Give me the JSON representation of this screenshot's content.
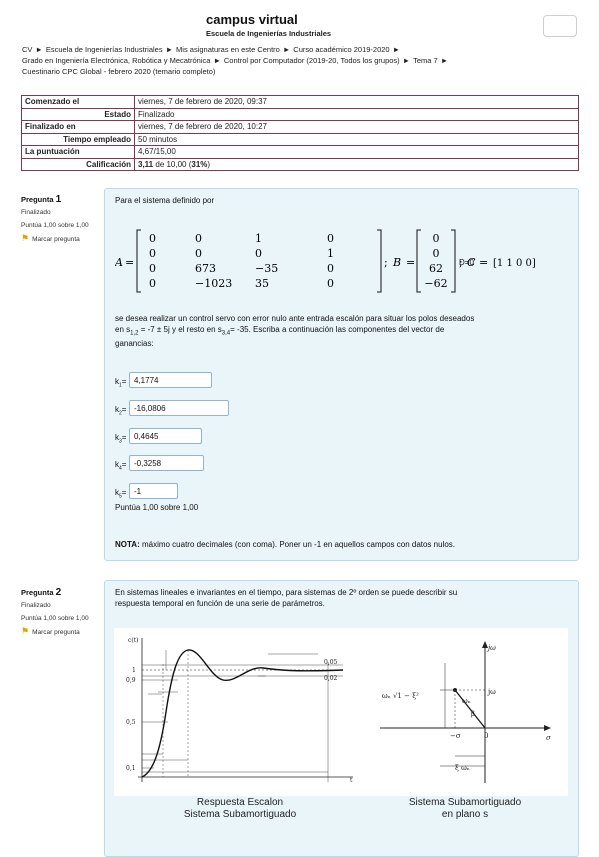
{
  "header": {
    "site_title": "campus virtual",
    "site_subtitle": "Escuela de Ingenierías Industriales"
  },
  "breadcrumb": {
    "items": [
      "CV",
      "Escuela de Ingenierías Industriales",
      "Mis asignaturas en este Centro",
      "Curso académico 2019-2020",
      "Grado en Ingeniería Electrónica, Robótica y Mecatrónica",
      "Control por Computador (2019-20, Todos los grupos)",
      "Tema 7",
      "Cuestinario CPC Global - febrero 2020 (temario completo)"
    ]
  },
  "summary": {
    "started_label": "Comenzado el",
    "started_value": "viernes, 7 de febrero de 2020, 09:37",
    "state_label": "Estado",
    "state_value": "Finalizado",
    "finished_label": "Finalizado en",
    "finished_value": "viernes, 7 de febrero de 2020, 10:27",
    "time_label": "Tiempo empleado",
    "time_value": "50 minutos",
    "score_label": "La puntuación",
    "score_value": "4,67/15,00",
    "grade_label": "Calificación",
    "grade_bold": "3,11",
    "grade_rest1": " de 10,00 (",
    "grade_percent": "31%",
    "grade_rest2": ")"
  },
  "q1": {
    "label": "Pregunta",
    "number": "1",
    "status": "Finalizado",
    "points": "Puntúa 1,00 sobre 1,00",
    "flag_label": "Marcar pregunta",
    "intro": "Para el sistema definido por",
    "matrix_A": [
      [
        "0",
        "0",
        "1",
        "0"
      ],
      [
        "0",
        "0",
        "0",
        "1"
      ],
      [
        "0",
        "673",
        "−35",
        "0"
      ],
      [
        "0",
        "−1023",
        "35",
        "0"
      ]
    ],
    "matrix_B": [
      "0",
      "0",
      "62",
      "−62"
    ],
    "matrix_C": "[1   1   0   0]",
    "d_label": "D=0",
    "para1": "se desea realizar un control servo con error nulo ante entrada escalón para situar los polos deseados",
    "para2a": "en s",
    "para2_sub1": "1,2",
    "para2b": " = -7 ± 5j y el resto en s",
    "para2_sub2": "3,4",
    "para2c": "= -35. Escriba a continuación las componentes del vector de",
    "para3": "ganancias:",
    "k": [
      {
        "sub": "1",
        "value": "4,1774"
      },
      {
        "sub": "2",
        "value": "-16,0806"
      },
      {
        "sub": "3",
        "value": "0,4645"
      },
      {
        "sub": "4",
        "value": "-0,3258"
      },
      {
        "sub": "5",
        "value": "-1"
      }
    ],
    "answer_points": "Puntúa 1,00 sobre 1,00",
    "note_bold": "NOTA:",
    "note_text": " máximo cuatro decimales (con coma). Poner un -1 en aquellos campos con datos nulos."
  },
  "q2": {
    "label": "Pregunta",
    "number": "2",
    "status": "Finalizado",
    "points": "Puntúa 1,00 sobre 1,00",
    "flag_label": "Marcar pregunta",
    "text1": "En sistemas lineales e invariantes en el tiempo, para sistemas de 2º orden se puede describir su",
    "text2": "respuesta temporal en función de una serie de parámetros.",
    "fig1_caption1": "Respuesta Escalon",
    "fig1_caption2": "Sistema Subamortiguado",
    "fig2_caption1": "Sistema Subamortiguado",
    "fig2_caption2": "en plano s"
  }
}
